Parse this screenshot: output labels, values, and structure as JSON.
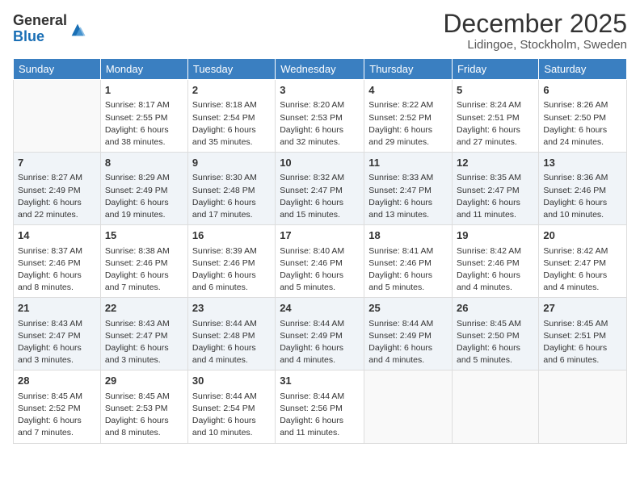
{
  "logo": {
    "general": "General",
    "blue": "Blue"
  },
  "header": {
    "month": "December 2025",
    "location": "Lidingoe, Stockholm, Sweden"
  },
  "weekdays": [
    "Sunday",
    "Monday",
    "Tuesday",
    "Wednesday",
    "Thursday",
    "Friday",
    "Saturday"
  ],
  "weeks": [
    [
      {
        "day": "",
        "info": ""
      },
      {
        "day": "1",
        "info": "Sunrise: 8:17 AM\nSunset: 2:55 PM\nDaylight: 6 hours\nand 38 minutes."
      },
      {
        "day": "2",
        "info": "Sunrise: 8:18 AM\nSunset: 2:54 PM\nDaylight: 6 hours\nand 35 minutes."
      },
      {
        "day": "3",
        "info": "Sunrise: 8:20 AM\nSunset: 2:53 PM\nDaylight: 6 hours\nand 32 minutes."
      },
      {
        "day": "4",
        "info": "Sunrise: 8:22 AM\nSunset: 2:52 PM\nDaylight: 6 hours\nand 29 minutes."
      },
      {
        "day": "5",
        "info": "Sunrise: 8:24 AM\nSunset: 2:51 PM\nDaylight: 6 hours\nand 27 minutes."
      },
      {
        "day": "6",
        "info": "Sunrise: 8:26 AM\nSunset: 2:50 PM\nDaylight: 6 hours\nand 24 minutes."
      }
    ],
    [
      {
        "day": "7",
        "info": "Sunrise: 8:27 AM\nSunset: 2:49 PM\nDaylight: 6 hours\nand 22 minutes."
      },
      {
        "day": "8",
        "info": "Sunrise: 8:29 AM\nSunset: 2:49 PM\nDaylight: 6 hours\nand 19 minutes."
      },
      {
        "day": "9",
        "info": "Sunrise: 8:30 AM\nSunset: 2:48 PM\nDaylight: 6 hours\nand 17 minutes."
      },
      {
        "day": "10",
        "info": "Sunrise: 8:32 AM\nSunset: 2:47 PM\nDaylight: 6 hours\nand 15 minutes."
      },
      {
        "day": "11",
        "info": "Sunrise: 8:33 AM\nSunset: 2:47 PM\nDaylight: 6 hours\nand 13 minutes."
      },
      {
        "day": "12",
        "info": "Sunrise: 8:35 AM\nSunset: 2:47 PM\nDaylight: 6 hours\nand 11 minutes."
      },
      {
        "day": "13",
        "info": "Sunrise: 8:36 AM\nSunset: 2:46 PM\nDaylight: 6 hours\nand 10 minutes."
      }
    ],
    [
      {
        "day": "14",
        "info": "Sunrise: 8:37 AM\nSunset: 2:46 PM\nDaylight: 6 hours\nand 8 minutes."
      },
      {
        "day": "15",
        "info": "Sunrise: 8:38 AM\nSunset: 2:46 PM\nDaylight: 6 hours\nand 7 minutes."
      },
      {
        "day": "16",
        "info": "Sunrise: 8:39 AM\nSunset: 2:46 PM\nDaylight: 6 hours\nand 6 minutes."
      },
      {
        "day": "17",
        "info": "Sunrise: 8:40 AM\nSunset: 2:46 PM\nDaylight: 6 hours\nand 5 minutes."
      },
      {
        "day": "18",
        "info": "Sunrise: 8:41 AM\nSunset: 2:46 PM\nDaylight: 6 hours\nand 5 minutes."
      },
      {
        "day": "19",
        "info": "Sunrise: 8:42 AM\nSunset: 2:46 PM\nDaylight: 6 hours\nand 4 minutes."
      },
      {
        "day": "20",
        "info": "Sunrise: 8:42 AM\nSunset: 2:47 PM\nDaylight: 6 hours\nand 4 minutes."
      }
    ],
    [
      {
        "day": "21",
        "info": "Sunrise: 8:43 AM\nSunset: 2:47 PM\nDaylight: 6 hours\nand 3 minutes."
      },
      {
        "day": "22",
        "info": "Sunrise: 8:43 AM\nSunset: 2:47 PM\nDaylight: 6 hours\nand 3 minutes."
      },
      {
        "day": "23",
        "info": "Sunrise: 8:44 AM\nSunset: 2:48 PM\nDaylight: 6 hours\nand 4 minutes."
      },
      {
        "day": "24",
        "info": "Sunrise: 8:44 AM\nSunset: 2:49 PM\nDaylight: 6 hours\nand 4 minutes."
      },
      {
        "day": "25",
        "info": "Sunrise: 8:44 AM\nSunset: 2:49 PM\nDaylight: 6 hours\nand 4 minutes."
      },
      {
        "day": "26",
        "info": "Sunrise: 8:45 AM\nSunset: 2:50 PM\nDaylight: 6 hours\nand 5 minutes."
      },
      {
        "day": "27",
        "info": "Sunrise: 8:45 AM\nSunset: 2:51 PM\nDaylight: 6 hours\nand 6 minutes."
      }
    ],
    [
      {
        "day": "28",
        "info": "Sunrise: 8:45 AM\nSunset: 2:52 PM\nDaylight: 6 hours\nand 7 minutes."
      },
      {
        "day": "29",
        "info": "Sunrise: 8:45 AM\nSunset: 2:53 PM\nDaylight: 6 hours\nand 8 minutes."
      },
      {
        "day": "30",
        "info": "Sunrise: 8:44 AM\nSunset: 2:54 PM\nDaylight: 6 hours\nand 10 minutes."
      },
      {
        "day": "31",
        "info": "Sunrise: 8:44 AM\nSunset: 2:56 PM\nDaylight: 6 hours\nand 11 minutes."
      },
      {
        "day": "",
        "info": ""
      },
      {
        "day": "",
        "info": ""
      },
      {
        "day": "",
        "info": ""
      }
    ]
  ]
}
